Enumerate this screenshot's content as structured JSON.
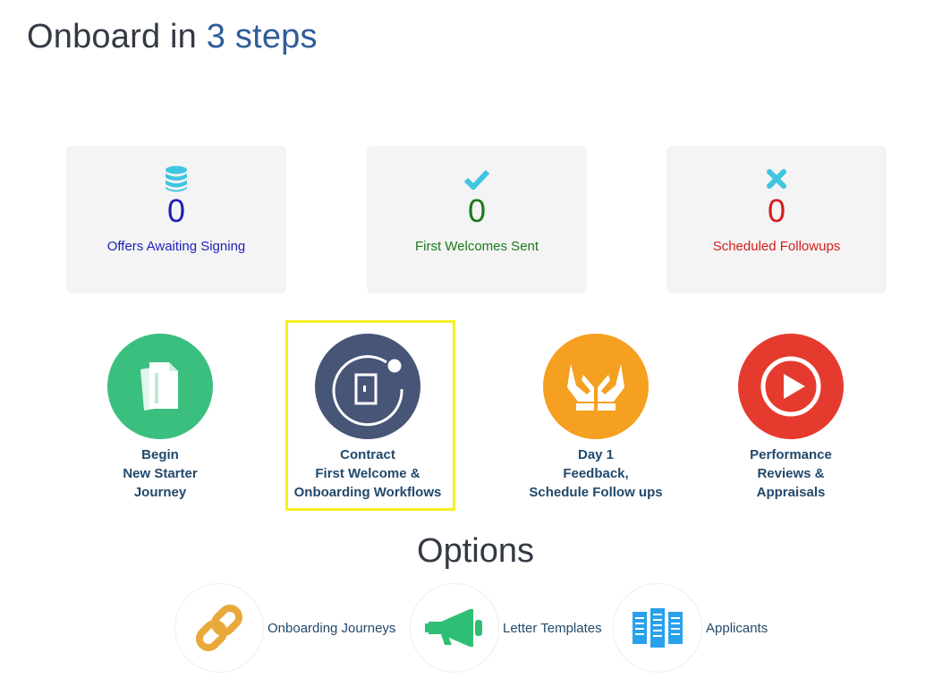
{
  "header": {
    "title_prefix": "Onboard in",
    "title_accent": "3 steps"
  },
  "stats": [
    {
      "icon": "database-icon",
      "value": "0",
      "label": "Offers Awaiting Signing",
      "color": "#1f1fb8",
      "icon_color": "#3ec6e0"
    },
    {
      "icon": "checkmark-icon",
      "value": "0",
      "label": "First Welcomes Sent",
      "color": "#1b7a1b",
      "icon_color": "#3ec6e0"
    },
    {
      "icon": "close-x-icon",
      "value": "0",
      "label": "Scheduled Followups",
      "color": "#d81c1c",
      "icon_color": "#3ec6e0"
    }
  ],
  "steps": [
    {
      "icon": "documents-icon",
      "color": "#3bbf7f",
      "lines": [
        "Begin",
        "New Starter",
        "Journey"
      ]
    },
    {
      "icon": "door-icon",
      "color": "#475577",
      "lines": [
        "Contract",
        "First Welcome &",
        "Onboarding Workflows"
      ],
      "highlighted": true
    },
    {
      "icon": "hands-icon",
      "color": "#f5a020",
      "lines": [
        "Day 1",
        "Feedback,",
        "Schedule Follow ups"
      ]
    },
    {
      "icon": "play-icon",
      "color": "#e53b2f",
      "lines": [
        "Performance",
        "Reviews &",
        "Appraisals"
      ]
    }
  ],
  "options": {
    "heading": "Options",
    "items": [
      {
        "icon": "link-icon",
        "label": "Onboarding Journeys",
        "color": "#e8a93a"
      },
      {
        "icon": "megaphone-icon",
        "label": "Letter Templates",
        "color": "#2fbf74"
      },
      {
        "icon": "server-rack-icon",
        "label": "Applicants",
        "color": "#2aa1ec"
      }
    ]
  }
}
